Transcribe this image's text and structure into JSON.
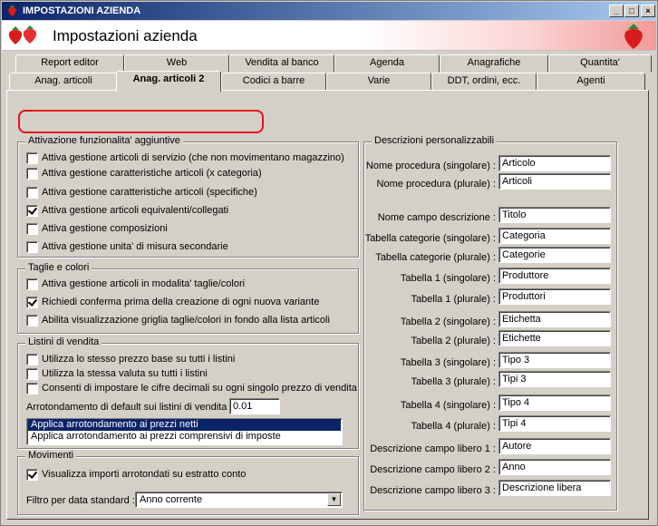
{
  "window": {
    "title": "IMPOSTAZIONI AZIENDA",
    "min_label": "_",
    "max_label": "□",
    "close_label": "×"
  },
  "header": {
    "title": "Impostazioni azienda"
  },
  "tabs_back": [
    "Report editor",
    "Web",
    "Vendita al banco",
    "Agenda",
    "Anagrafiche",
    "Quantita'"
  ],
  "tabs_front": [
    "Anag. articoli",
    "Anag. articoli 2",
    "Codici a barre",
    "Varie",
    "DDT, ordini, ecc.",
    "Agenti"
  ],
  "active_tab": "Anag. articoli 2",
  "attivazione": {
    "title": "Attivazione funzionalita' aggiuntive",
    "items": [
      {
        "label": "Attiva gestione articoli di servizio (che non movimentano magazzino)",
        "checked": false
      },
      {
        "label": "Attiva gestione caratteristiche articoli (x categoria)",
        "checked": false
      },
      {
        "label": "Attiva gestione caratteristiche articoli (specifiche)",
        "checked": false
      },
      {
        "label": "Attiva gestione articoli equivalenti/collegati",
        "checked": true
      },
      {
        "label": "Attiva gestione composizioni",
        "checked": false
      },
      {
        "label": "Attiva gestione unita' di misura secondarie",
        "checked": false
      }
    ]
  },
  "taglie": {
    "title": "Taglie e colori",
    "items": [
      {
        "label": "Attiva gestione articoli in modalita' taglie/colori",
        "checked": false
      },
      {
        "label": "Richiedi conferma prima della creazione di ogni nuova variante",
        "checked": true
      },
      {
        "label": "Abilita visualizzazione griglia taglie/colori in fondo alla lista articoli",
        "checked": false
      }
    ]
  },
  "listini": {
    "title": "Listini di vendita",
    "items": [
      {
        "label": "Utilizza lo stesso prezzo base su tutti i listini",
        "checked": false
      },
      {
        "label": "Utilizza la stessa valuta su tutti i listini",
        "checked": false
      },
      {
        "label": "Consenti di impostare le cifre decimali su ogni singolo prezzo di vendita",
        "checked": false
      }
    ],
    "arrotondamento_label": "Arrotondamento di default sui listini di vendita :",
    "arrotondamento_value": "0.01",
    "options": [
      "Applica arrotondamento ai prezzi netti",
      "Applica arrotondamento ai prezzi comprensivi di imposte"
    ],
    "selected_option": "Applica arrotondamento ai prezzi netti"
  },
  "movimenti": {
    "title": "Movimenti",
    "items": [
      {
        "label": "Visualizza importi arrotondati su estratto conto",
        "checked": true
      }
    ],
    "filtro_label": "Filtro per data standard :",
    "filtro_value": "Anno corrente"
  },
  "descrizioni": {
    "title": "Descrizioni personalizzabili",
    "fields": [
      {
        "label": "Nome procedura (singolare) :",
        "value": "Articolo"
      },
      {
        "label": "Nome procedura (plurale) :",
        "value": "Articoli"
      },
      {
        "label": "Nome campo descrizione :",
        "value": "Titolo"
      },
      {
        "label": "Tabella categorie (singolare) :",
        "value": "Categoria"
      },
      {
        "label": "Tabella categorie (plurale) :",
        "value": "Categorie"
      },
      {
        "label": "Tabella 1 (singolare) :",
        "value": "Produttore"
      },
      {
        "label": "Tabella 1 (plurale) :",
        "value": "Produttori"
      },
      {
        "label": "Tabella 2 (singolare) :",
        "value": "Etichetta"
      },
      {
        "label": "Tabella 2 (plurale) :",
        "value": "Etichette"
      },
      {
        "label": "Tabella 3 (singolare) :",
        "value": "Tipo 3"
      },
      {
        "label": "Tabella 3 (plurale) :",
        "value": "Tipi 3"
      },
      {
        "label": "Tabella 4 (singolare) :",
        "value": "Tipo 4"
      },
      {
        "label": "Tabella 4 (plurale) :",
        "value": "Tipi 4"
      },
      {
        "label": "Descrizione campo libero 1 :",
        "value": "Autore"
      },
      {
        "label": "Descrizione campo libero 2 :",
        "value": "Anno"
      },
      {
        "label": "Descrizione campo libero 3 :",
        "value": "Descrizione libera"
      }
    ]
  },
  "colors": {
    "title_start": "#0a246a",
    "title_end": "#a6caf0",
    "highlight": "#e8101a",
    "selection": "#0a246a",
    "face": "#d4d0c8"
  },
  "icons": {
    "app": "strawberry-icon",
    "logo": "strawberries-icon"
  }
}
